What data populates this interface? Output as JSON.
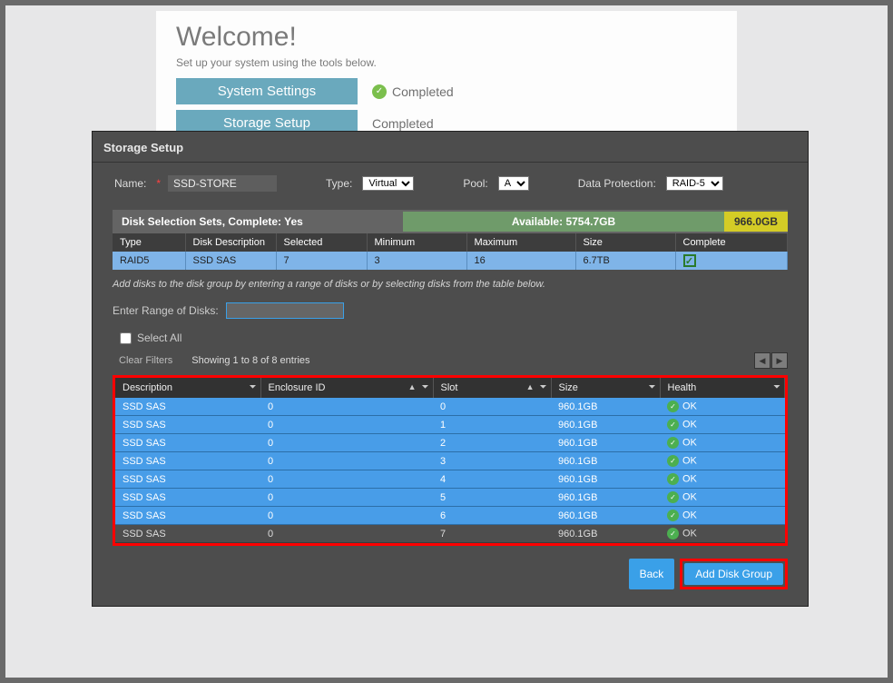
{
  "welcome": {
    "title": "Welcome!",
    "subtitle": "Set up your system using the tools below.",
    "steps": [
      {
        "label": "System Settings",
        "status": "Completed",
        "showIcon": true
      },
      {
        "label": "Storage Setup",
        "status": "Completed",
        "showIcon": false
      }
    ]
  },
  "modal": {
    "title": "Storage Setup",
    "form": {
      "name_label": "Name:",
      "name_value": "SSD-STORE",
      "type_label": "Type:",
      "type_value": "Virtual",
      "pool_label": "Pool:",
      "pool_value": "A",
      "dp_label": "Data Protection:",
      "dp_value": "RAID-5"
    },
    "disk_selection": {
      "heading": "Disk Selection Sets, Complete: Yes",
      "available_label": "Available: 5754.7GB",
      "used_label": "966.0GB",
      "cols": {
        "type": "Type",
        "desc": "Disk Description",
        "selected": "Selected",
        "min": "Minimum",
        "max": "Maximum",
        "size": "Size",
        "complete": "Complete"
      },
      "row": {
        "type": "RAID5",
        "desc": "SSD SAS",
        "selected": "7",
        "min": "3",
        "max": "16",
        "size": "6.7TB"
      }
    },
    "instruction": "Add disks to the disk group by entering a range of disks or by selecting disks from the table below.",
    "enter_range_label": "Enter Range of Disks:",
    "select_all_label": "Select All",
    "clear_filters_label": "Clear Filters",
    "showing_text": "Showing 1 to 8 of 8 entries",
    "disk_cols": {
      "desc": "Description",
      "encl": "Enclosure ID",
      "slot": "Slot",
      "size": "Size",
      "health": "Health"
    },
    "disks": [
      {
        "desc": "SSD SAS",
        "encl": "0",
        "slot": "0",
        "size": "960.1GB",
        "health": "OK",
        "selected": true
      },
      {
        "desc": "SSD SAS",
        "encl": "0",
        "slot": "1",
        "size": "960.1GB",
        "health": "OK",
        "selected": true
      },
      {
        "desc": "SSD SAS",
        "encl": "0",
        "slot": "2",
        "size": "960.1GB",
        "health": "OK",
        "selected": true
      },
      {
        "desc": "SSD SAS",
        "encl": "0",
        "slot": "3",
        "size": "960.1GB",
        "health": "OK",
        "selected": true
      },
      {
        "desc": "SSD SAS",
        "encl": "0",
        "slot": "4",
        "size": "960.1GB",
        "health": "OK",
        "selected": true
      },
      {
        "desc": "SSD SAS",
        "encl": "0",
        "slot": "5",
        "size": "960.1GB",
        "health": "OK",
        "selected": true
      },
      {
        "desc": "SSD SAS",
        "encl": "0",
        "slot": "6",
        "size": "960.1GB",
        "health": "OK",
        "selected": true
      },
      {
        "desc": "SSD SAS",
        "encl": "0",
        "slot": "7",
        "size": "960.1GB",
        "health": "OK",
        "selected": false
      }
    ],
    "buttons": {
      "back": "Back",
      "add": "Add Disk Group"
    }
  }
}
